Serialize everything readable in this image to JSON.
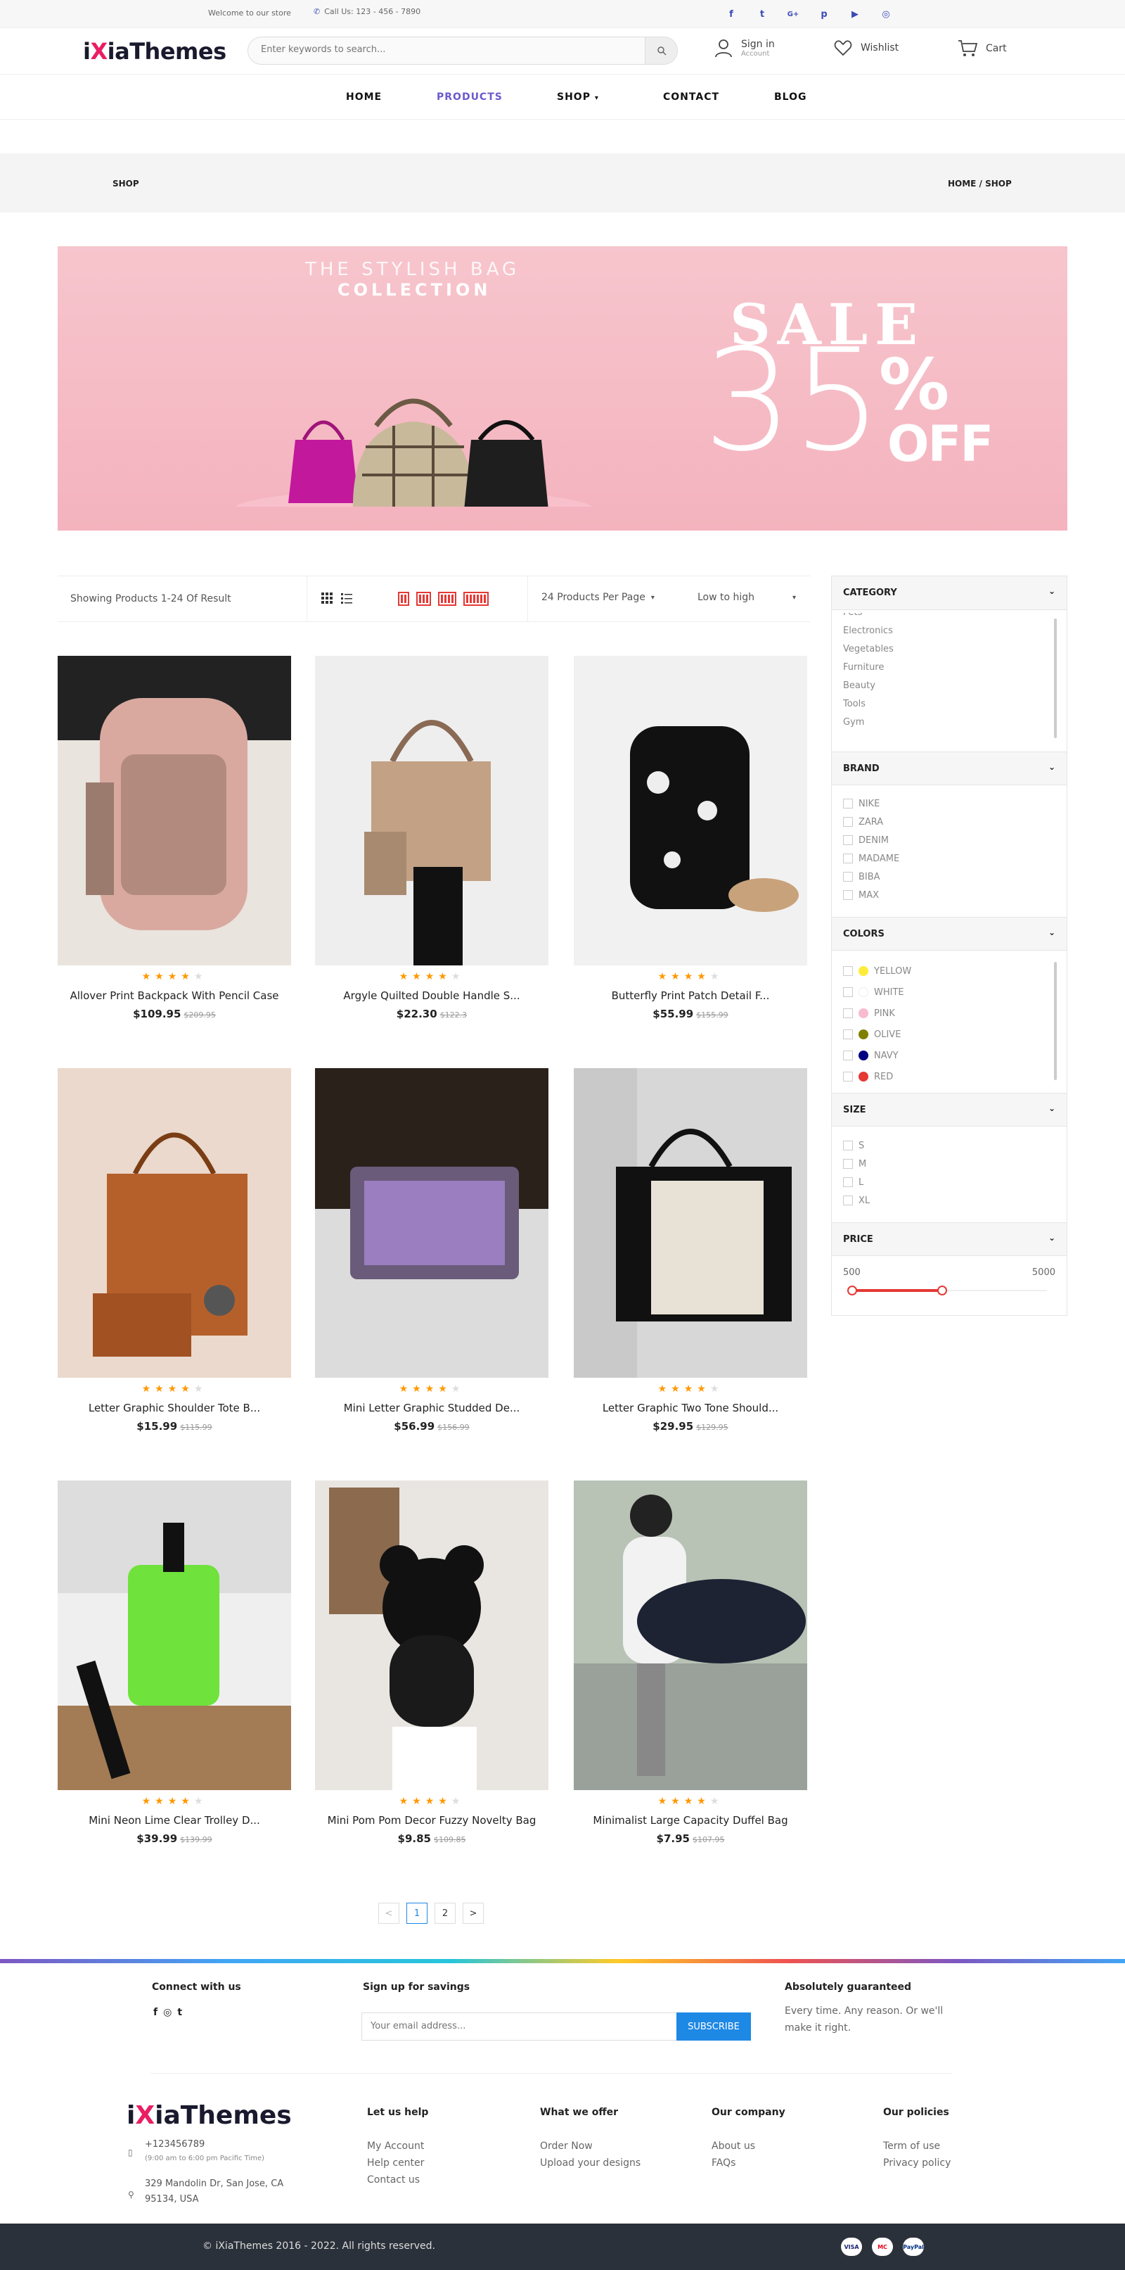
{
  "topbar": {
    "welcome": "Welcome to our store",
    "phone": "Call Us: 123 - 456 - 7890",
    "socials": [
      "facebook-icon",
      "twitter-icon",
      "google-plus-icon",
      "pinterest-icon",
      "youtube-icon",
      "instagram-icon"
    ]
  },
  "header": {
    "logo_pre": "i",
    "logo_x": "X",
    "logo_post": "iaThemes",
    "search_placeholder": "Enter keywords to search...",
    "signin": "Sign in",
    "signin_sub": "Account",
    "wishlist": "Wishlist",
    "cart": "Cart"
  },
  "nav": {
    "home": "HOME",
    "products": "PRODUCTS",
    "shop": "SHOP",
    "contact": "CONTACT",
    "blog": "BLOG"
  },
  "breadcrumb": {
    "title": "SHOP",
    "path": "HOME / SHOP"
  },
  "banner": {
    "caption1": "THE STYLISH BAG",
    "caption2": "COLLECTION",
    "sale": "SALE",
    "percent": "35",
    "percent_sign": "%",
    "off": "OFF"
  },
  "toolbar": {
    "result": "Showing Products 1-24 Of Result",
    "per_page": "24 Products Per Page",
    "sort": "Low to high"
  },
  "products": [
    {
      "name": "Allover Print Backpack With Pencil Case",
      "price": "$109.95",
      "old": "$209.95",
      "rating": 4
    },
    {
      "name": "Argyle Quilted Double Handle S...",
      "price": "$22.30",
      "old": "$122.3",
      "rating": 4
    },
    {
      "name": "Butterfly Print Patch Detail F...",
      "price": "$55.99",
      "old": "$155.99",
      "rating": 4
    },
    {
      "name": "Letter Graphic Shoulder Tote B...",
      "price": "$15.99",
      "old": "$115.99",
      "rating": 4
    },
    {
      "name": "Mini Letter Graphic Studded De...",
      "price": "$56.99",
      "old": "$156.99",
      "rating": 4
    },
    {
      "name": "Letter Graphic Two Tone Should...",
      "price": "$29.95",
      "old": "$129.95",
      "rating": 4
    },
    {
      "name": "Mini Neon Lime Clear Trolley D...",
      "price": "$39.99",
      "old": "$139.99",
      "rating": 4
    },
    {
      "name": "Mini Pom Pom Decor Fuzzy Novelty Bag",
      "price": "$9.85",
      "old": "$109.85",
      "rating": 4
    },
    {
      "name": "Minimalist Large Capacity Duffel Bag",
      "price": "$7.95",
      "old": "$107.95",
      "rating": 4
    }
  ],
  "sidebar": {
    "category_title": "CATEGORY",
    "categories": [
      "Pets",
      "Electronics",
      "Vegetables",
      "Furniture",
      "Beauty",
      "Tools",
      "Gym"
    ],
    "brand_title": "BRAND",
    "brands": [
      "NIKE",
      "ZARA",
      "DENIM",
      "MADAME",
      "BIBA",
      "MAX"
    ],
    "colors_title": "COLORS",
    "colors": [
      {
        "name": "YELLOW",
        "hex": "#ffeb3b"
      },
      {
        "name": "WHITE",
        "hex": "#ffffff"
      },
      {
        "name": "PINK",
        "hex": "#f8bbd0"
      },
      {
        "name": "OLIVE",
        "hex": "#808000"
      },
      {
        "name": "NAVY",
        "hex": "#000080"
      },
      {
        "name": "RED",
        "hex": "#e53935"
      }
    ],
    "size_title": "SIZE",
    "sizes": [
      "S",
      "M",
      "L",
      "XL"
    ],
    "price_title": "PRICE",
    "price_min": "500",
    "price_max": "5000"
  },
  "pagination": {
    "prev": "<",
    "p1": "1",
    "p2": "2",
    "next": ">"
  },
  "footer": {
    "connect_title": "Connect with us",
    "signup_title": "Sign up for savings",
    "email_placeholder": "Your email address...",
    "subscribe": "SUBSCRIBE",
    "guarantee_title": "Absolutely guaranteed",
    "guarantee_text1": "Every time. Any reason. Or we'll",
    "guarantee_text2": "make it right.",
    "phone": "+123456789",
    "hours": "(9:00 am to 6:00 pm Pacific Time)",
    "addr1": "329 Mandolin Dr, San Jose, CA",
    "addr2": "95134, USA",
    "col1_title": "Let us help",
    "col1": [
      "My Account",
      "Help center",
      "Contact us"
    ],
    "col2_title": "What we offer",
    "col2": [
      "Order Now",
      "Upload your designs"
    ],
    "col3_title": "Our company",
    "col3": [
      "About us",
      "FAQs"
    ],
    "col4_title": "Our policies",
    "col4": [
      "Term of use",
      "Privacy policy"
    ],
    "copyright": "© iXiaThemes 2016 - 2022. All rights reserved.",
    "payments": [
      "VISA",
      "MC",
      "PayPal"
    ]
  },
  "colors": {
    "accent": "#6a5acd",
    "brand_pink": "#e91e63",
    "star": "#ff9800",
    "button_blue": "#1e88e5"
  }
}
